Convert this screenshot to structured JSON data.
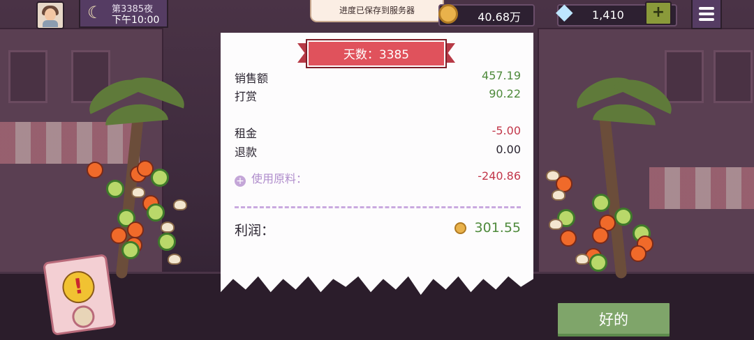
{
  "top_bar": {
    "night_label": "第3385夜",
    "time_label": "下午10:00",
    "toast": "进度已保存到服务器",
    "coins": "40.68万",
    "gems": "1,410",
    "add_label": "+"
  },
  "receipt": {
    "title": "天数：3385",
    "sales_label": "销售额",
    "sales_value": "457.19",
    "tips_label": "打赏",
    "tips_value": "90.22",
    "rent_label": "租金",
    "rent_value": "-5.00",
    "refund_label": "退款",
    "refund_value": "0.00",
    "ingredients_label": "使用原料：",
    "ingredients_value": "-240.86",
    "profit_label": "利润：",
    "profit_value": "301.55"
  },
  "alert_label": "!",
  "ok_button": "好的"
}
